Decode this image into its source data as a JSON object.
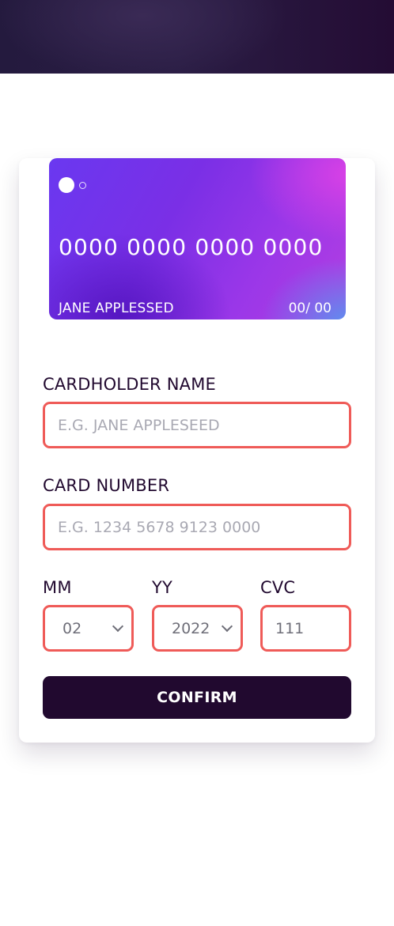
{
  "card": {
    "number": "0000 0000 0000 0000",
    "holder": "JANE APPLESSED",
    "expiry": "00/ 00"
  },
  "form": {
    "cardholder_label": "CARDHOLDER NAME",
    "cardholder_placeholder": "E.G. JANE APPLESEED",
    "number_label": "CARD NUMBER",
    "number_placeholder": "E.G. 1234 5678 9123 0000",
    "mm_label": "MM",
    "mm_value": "02",
    "yy_label": "YY",
    "yy_value": "2022",
    "cvc_label": "CVC",
    "cvc_value": "111",
    "confirm_label": "CONFIRM"
  },
  "colors": {
    "error_border": "#ef5b58",
    "dark": "#21092f"
  }
}
